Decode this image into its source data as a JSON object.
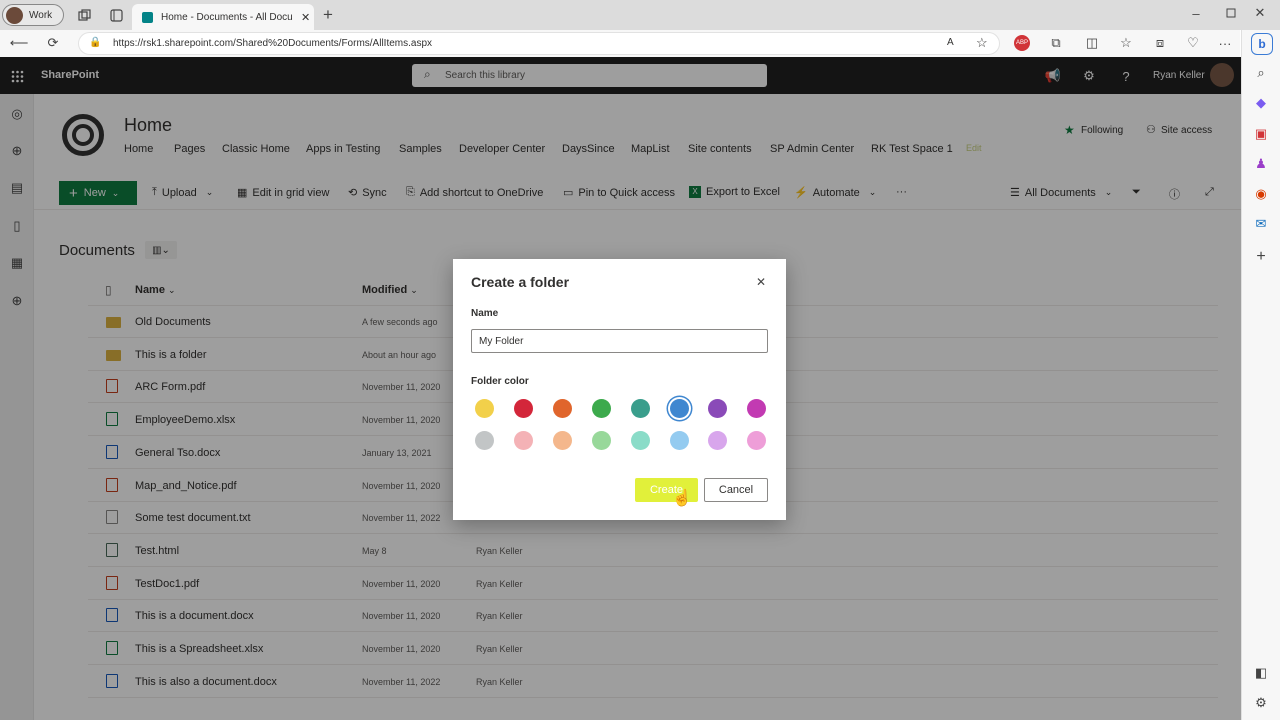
{
  "browser": {
    "profile_label": "Work",
    "tab_title": "Home - Documents - All Documen",
    "url": "https://rsk1.sharepoint.com/Shared%20Documents/Forms/AllItems.aspx",
    "new_tab_symbol": "+",
    "more_symbol": "···"
  },
  "suite": {
    "app_name": "SharePoint",
    "search_placeholder": "Search this library",
    "user_name": "Ryan Keller"
  },
  "site": {
    "title": "Home",
    "nav": [
      "Home",
      "Pages",
      "Classic Home",
      "Apps in Testing",
      "Samples",
      "Developer Center",
      "DaysSince",
      "MapList",
      "Site contents",
      "SP Admin Center",
      "RK Test Space 1",
      "Edit"
    ],
    "following_label": "Following",
    "site_access_label": "Site access"
  },
  "commands": {
    "new": "New",
    "upload": "Upload",
    "edit_grid": "Edit in grid view",
    "sync": "Sync",
    "shortcut": "Add shortcut to OneDrive",
    "pin": "Pin to Quick access",
    "export": "Export to Excel",
    "automate": "Automate",
    "more": "···",
    "view": "All Documents"
  },
  "library": {
    "title": "Documents",
    "columns": {
      "name": "Name",
      "modified": "Modified"
    },
    "rows": [
      {
        "name": "Old Documents",
        "modified": "A few seconds ago",
        "by": "",
        "type": "folder"
      },
      {
        "name": "This is a folder",
        "modified": "About an hour ago",
        "by": "",
        "type": "folder"
      },
      {
        "name": "ARC Form.pdf",
        "modified": "November 11, 2020",
        "by": "",
        "type": "pdf"
      },
      {
        "name": "EmployeeDemo.xlsx",
        "modified": "November 11, 2020",
        "by": "",
        "type": "xlsx"
      },
      {
        "name": "General Tso.docx",
        "modified": "January 13, 2021",
        "by": "",
        "type": "docx"
      },
      {
        "name": "Map_and_Notice.pdf",
        "modified": "November 11, 2020",
        "by": "",
        "type": "pdf"
      },
      {
        "name": "Some test document.txt",
        "modified": "November 11, 2022",
        "by": "",
        "type": "txt"
      },
      {
        "name": "Test.html",
        "modified": "May 8",
        "by": "Ryan Keller",
        "type": "html"
      },
      {
        "name": "TestDoc1.pdf",
        "modified": "November 11, 2020",
        "by": "Ryan Keller",
        "type": "pdf"
      },
      {
        "name": "This is a document.docx",
        "modified": "November 11, 2020",
        "by": "Ryan Keller",
        "type": "docx"
      },
      {
        "name": "This is a Spreadsheet.xlsx",
        "modified": "November 11, 2020",
        "by": "Ryan Keller",
        "type": "xlsx"
      },
      {
        "name": "This is also a document.docx",
        "modified": "November 11, 2022",
        "by": "Ryan Keller",
        "type": "docx"
      }
    ]
  },
  "dialog": {
    "title": "Create a folder",
    "name_label": "Name",
    "name_value": "My Folder",
    "color_label": "Folder color",
    "colors_row1": [
      "#f2d04a",
      "#d3263a",
      "#e0652c",
      "#3caa4c",
      "#3a9e8c",
      "#3f87d0",
      "#8a4ab8",
      "#c23ab2"
    ],
    "colors_row2": [
      "#c2c5c6",
      "#f4b2b6",
      "#f4b78c",
      "#98d89a",
      "#8adcc8",
      "#94cbf0",
      "#d8a6ec",
      "#ee9ed8"
    ],
    "selected_color_index": 5,
    "create_label": "Create",
    "cancel_label": "Cancel",
    "close_symbol": "✕"
  },
  "accent_colors": {
    "green": "#107c41",
    "create_button": "#e1f03a"
  }
}
